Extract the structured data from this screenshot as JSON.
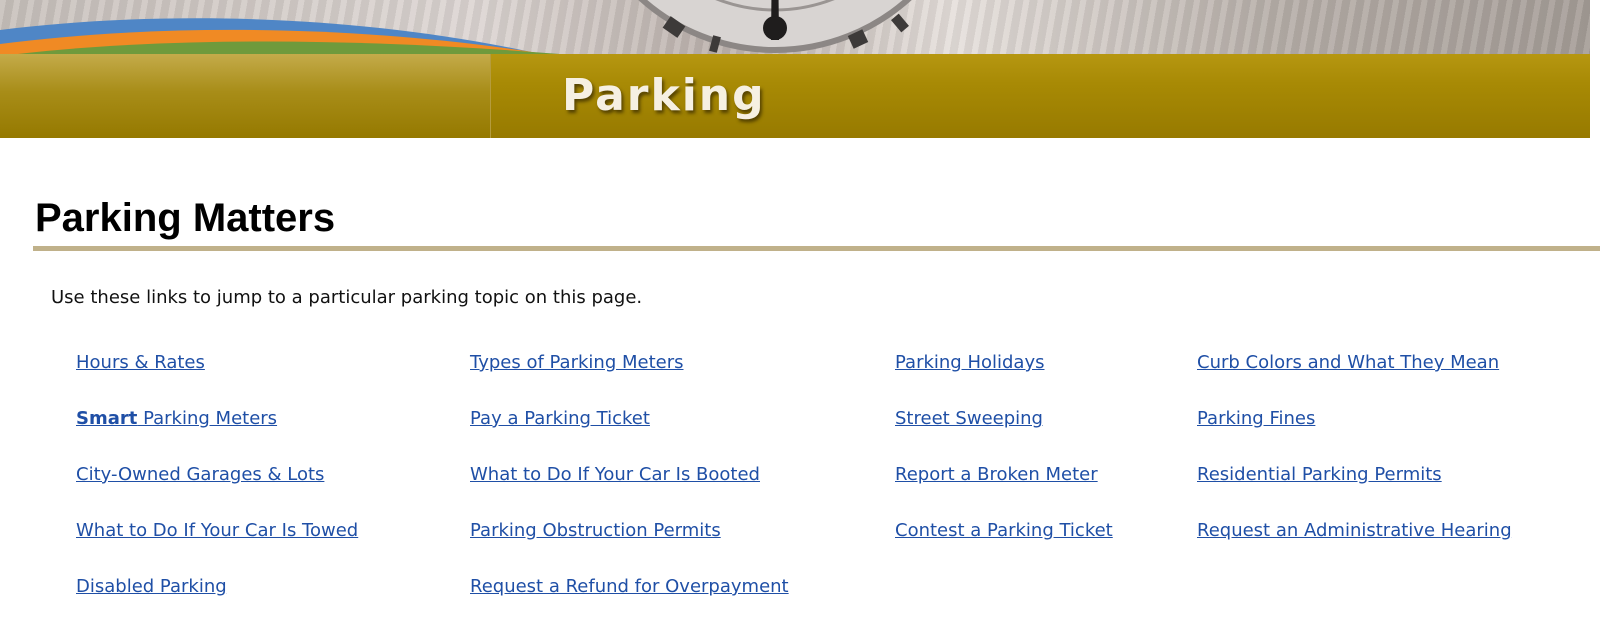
{
  "banner": {
    "title": "Parking",
    "colors": {
      "bar": "#a88a05",
      "swoosh_blue": "#4f86c6",
      "swoosh_orange": "#f08a24",
      "swoosh_green": "#6f9a3c"
    }
  },
  "page_title": "Parking Matters",
  "intro": "Use these links to jump to a particular parking topic on this page.",
  "links": {
    "hours_rates": "Hours & Rates",
    "smart_meters_bold": "Smart",
    "smart_meters_rest": " Parking Meters",
    "city_garages": "City-Owned Garages & Lots",
    "car_towed": "What to Do If Your Car Is Towed",
    "disabled_parking": "Disabled Parking",
    "meter_types": "Types of Parking Meters",
    "pay_ticket": "Pay a Parking Ticket",
    "car_booted": "What to Do If Your Car Is Booted",
    "obstruction_permits": "Parking Obstruction Permits",
    "refund_overpayment": "Request a Refund for Overpayment",
    "parking_holidays": "Parking Holidays",
    "street_sweeping": "Street Sweeping",
    "broken_meter": "Report a Broken Meter",
    "contest_ticket": "Contest a Parking Ticket",
    "curb_colors": "Curb Colors and What They Mean",
    "parking_fines": "Parking Fines",
    "residential_permits": "Residential Parking Permits",
    "admin_hearing": "Request an Administrative Hearing"
  },
  "colors": {
    "link": "#1f4fa6",
    "heading_rule": "#c0b18a"
  }
}
